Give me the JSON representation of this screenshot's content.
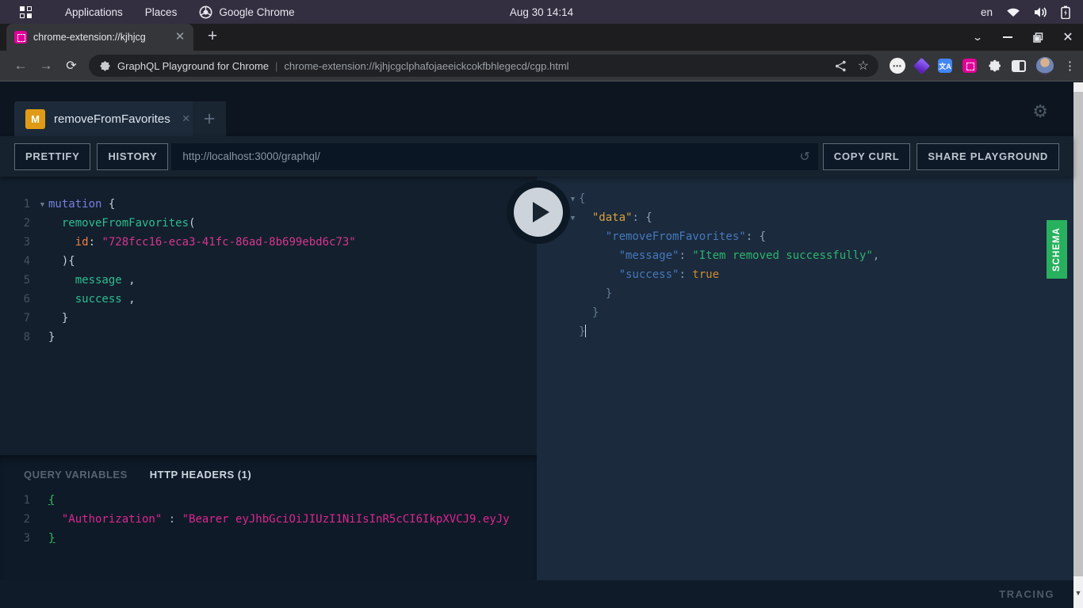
{
  "colors": {
    "schema_green": "#27b05e",
    "mutation_badge_orange": "#e09b16",
    "graphql_pink": "#e10098"
  },
  "system_bar": {
    "menu_applications": "Applications",
    "menu_places": "Places",
    "active_app": "Google Chrome",
    "clock": "Aug 30 14:14",
    "keyboard_layout": "en"
  },
  "browser": {
    "tab_title": "chrome-extension://kjhjcg",
    "omnibox": {
      "extension_name": "GraphQL Playground for Chrome",
      "separator": "|",
      "url": "chrome-extension://kjhjcgclphafojaeeickcokfbhlegecd/cgp.html"
    }
  },
  "playground": {
    "tab": {
      "badge": "M",
      "title": "removeFromFavorites",
      "close": "×"
    },
    "new_tab_label": "+",
    "toolbar": {
      "prettify": "PRETTIFY",
      "history": "HISTORY",
      "endpoint": "http://localhost:3000/graphql/",
      "copy_curl": "COPY CURL",
      "share": "SHARE PLAYGROUND"
    },
    "query": {
      "lines": [
        {
          "no": "1",
          "fold": true,
          "seg": [
            [
              "kw",
              "mutation"
            ],
            [
              "p",
              " {"
            ]
          ]
        },
        {
          "no": "2",
          "seg": [
            [
              "field",
              "  removeFromFavorites"
            ],
            [
              "p",
              "("
            ]
          ]
        },
        {
          "no": "3",
          "seg": [
            [
              "p",
              "    "
            ],
            [
              "attr",
              "id"
            ],
            [
              "p",
              ": "
            ],
            [
              "str",
              "\"728fcc16-eca3-41fc-86ad-8b699ebd6c73\""
            ]
          ]
        },
        {
          "no": "4",
          "seg": [
            [
              "p",
              "  ){"
            ]
          ]
        },
        {
          "no": "5",
          "seg": [
            [
              "field",
              "    message"
            ],
            [
              "p",
              " ,"
            ]
          ]
        },
        {
          "no": "6",
          "seg": [
            [
              "field",
              "    success"
            ],
            [
              "p",
              " ,"
            ]
          ]
        },
        {
          "no": "7",
          "seg": [
            [
              "p",
              "  }"
            ]
          ]
        },
        {
          "no": "8",
          "seg": [
            [
              "p",
              "}"
            ]
          ]
        }
      ]
    },
    "variables_panel": {
      "tab_query_variables": "QUERY VARIABLES",
      "tab_http_headers": "HTTP HEADERS (1)"
    },
    "headers": {
      "lines": [
        {
          "no": "1",
          "seg": [
            [
              "gb",
              "{"
            ]
          ]
        },
        {
          "no": "2",
          "seg": [
            [
              "pink",
              "  \"Authorization\""
            ],
            [
              "hp",
              " : "
            ],
            [
              "pink",
              "\"Bearer eyJhbGciOiJIUzI1NiIsInR5cCI6IkpXVCJ9.eyJy"
            ]
          ]
        },
        {
          "no": "3",
          "seg": [
            [
              "gb",
              "}"
            ]
          ]
        }
      ]
    },
    "response": {
      "lines": [
        {
          "fold": true,
          "seg": [
            [
              "rb",
              "{"
            ]
          ]
        },
        {
          "fold": true,
          "seg": [
            [
              "rp",
              "  "
            ],
            [
              "keyd",
              "\"data\""
            ],
            [
              "rp",
              ": {"
            ]
          ]
        },
        {
          "seg": [
            [
              "rp",
              "    "
            ],
            [
              "key",
              "\"removeFromFavorites\""
            ],
            [
              "rp",
              ": {"
            ]
          ]
        },
        {
          "seg": [
            [
              "rp",
              "      "
            ],
            [
              "key",
              "\"message\""
            ],
            [
              "rp",
              ": "
            ],
            [
              "vstr",
              "\"Item removed successfully\""
            ],
            [
              "rp",
              ","
            ]
          ]
        },
        {
          "seg": [
            [
              "rp",
              "      "
            ],
            [
              "key",
              "\"success\""
            ],
            [
              "rp",
              ": "
            ],
            [
              "bool",
              "true"
            ]
          ]
        },
        {
          "seg": [
            [
              "rb",
              "    }"
            ]
          ]
        },
        {
          "seg": [
            [
              "rb",
              "  }"
            ]
          ]
        },
        {
          "seg": [
            [
              "rb",
              "}"
            ]
          ],
          "cursor": true
        }
      ]
    },
    "schema_tab": "SCHEMA",
    "tracing": "TRACING"
  }
}
